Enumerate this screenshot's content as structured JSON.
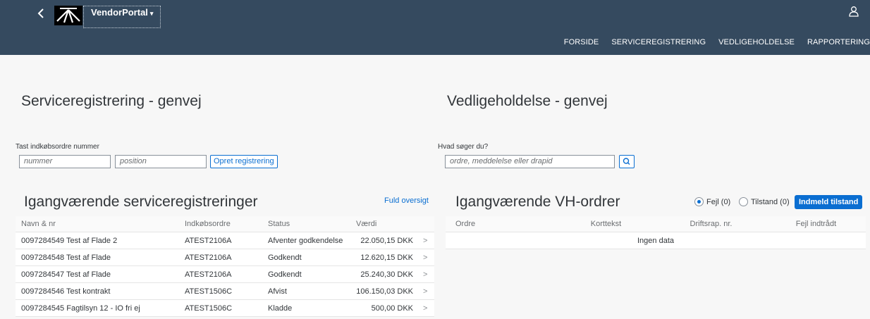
{
  "header": {
    "back_icon": "chevron-left-icon",
    "logo_icon": "banedanmark-logo",
    "app_title": "VendorPortal",
    "app_caret": "▾",
    "user_icon": "person-icon",
    "nav": [
      "FORSIDE",
      "SERVICEREGISTRERING",
      "VEDLIGEHOLDELSE",
      "RAPPORTERING"
    ]
  },
  "service": {
    "title": "Serviceregistrering - genvej",
    "po_label": "Tast indkøbsordre nummer",
    "number_placeholder": "nummer",
    "position_placeholder": "position",
    "create_button": "Opret registrering"
  },
  "maintenance": {
    "title": "Vedligeholdelse - genvej",
    "search_label": "Hvad søger du?",
    "search_placeholder": "ordre, meddelelse eller drapid",
    "search_icon": "search-icon"
  },
  "ongoing_service": {
    "title": "Igangværende serviceregistreringer",
    "full_overview_link": "Fuld oversigt",
    "columns": [
      "Navn & nr",
      "Indkøbsordre",
      "Status",
      "Værdi"
    ],
    "rows": [
      {
        "name": "0097284549 Test af Flade 2",
        "po": "ATEST2106A",
        "status": "Afventer godkendelse",
        "value": "22.050,15 DKK"
      },
      {
        "name": "0097284548 Test af Flade",
        "po": "ATEST2106A",
        "status": "Godkendt",
        "value": "12.620,15 DKK"
      },
      {
        "name": "0097284547 Test af Flade",
        "po": "ATEST2106A",
        "status": "Godkendt",
        "value": "25.240,30 DKK"
      },
      {
        "name": "0097284546 Test kontrakt",
        "po": "ATEST1506C",
        "status": "Afvist",
        "value": "106.150,03 DKK"
      },
      {
        "name": "0097284545 Fagtilsyn 12 - IO fri ej",
        "po": "ATEST1506C",
        "status": "Kladde",
        "value": "500,00 DKK"
      }
    ],
    "row_chevron": ">"
  },
  "ongoing_vh": {
    "title": "Igangværende VH-ordrer",
    "radio_fejl": "Fejl (0)",
    "radio_tilstand": "Tilstand (0)",
    "report_button": "Indmeld tilstand",
    "columns": [
      "Ordre",
      "Korttekst",
      "Driftsrap. nr.",
      "Fejl indtrådt"
    ],
    "empty_text": "Ingen data"
  }
}
